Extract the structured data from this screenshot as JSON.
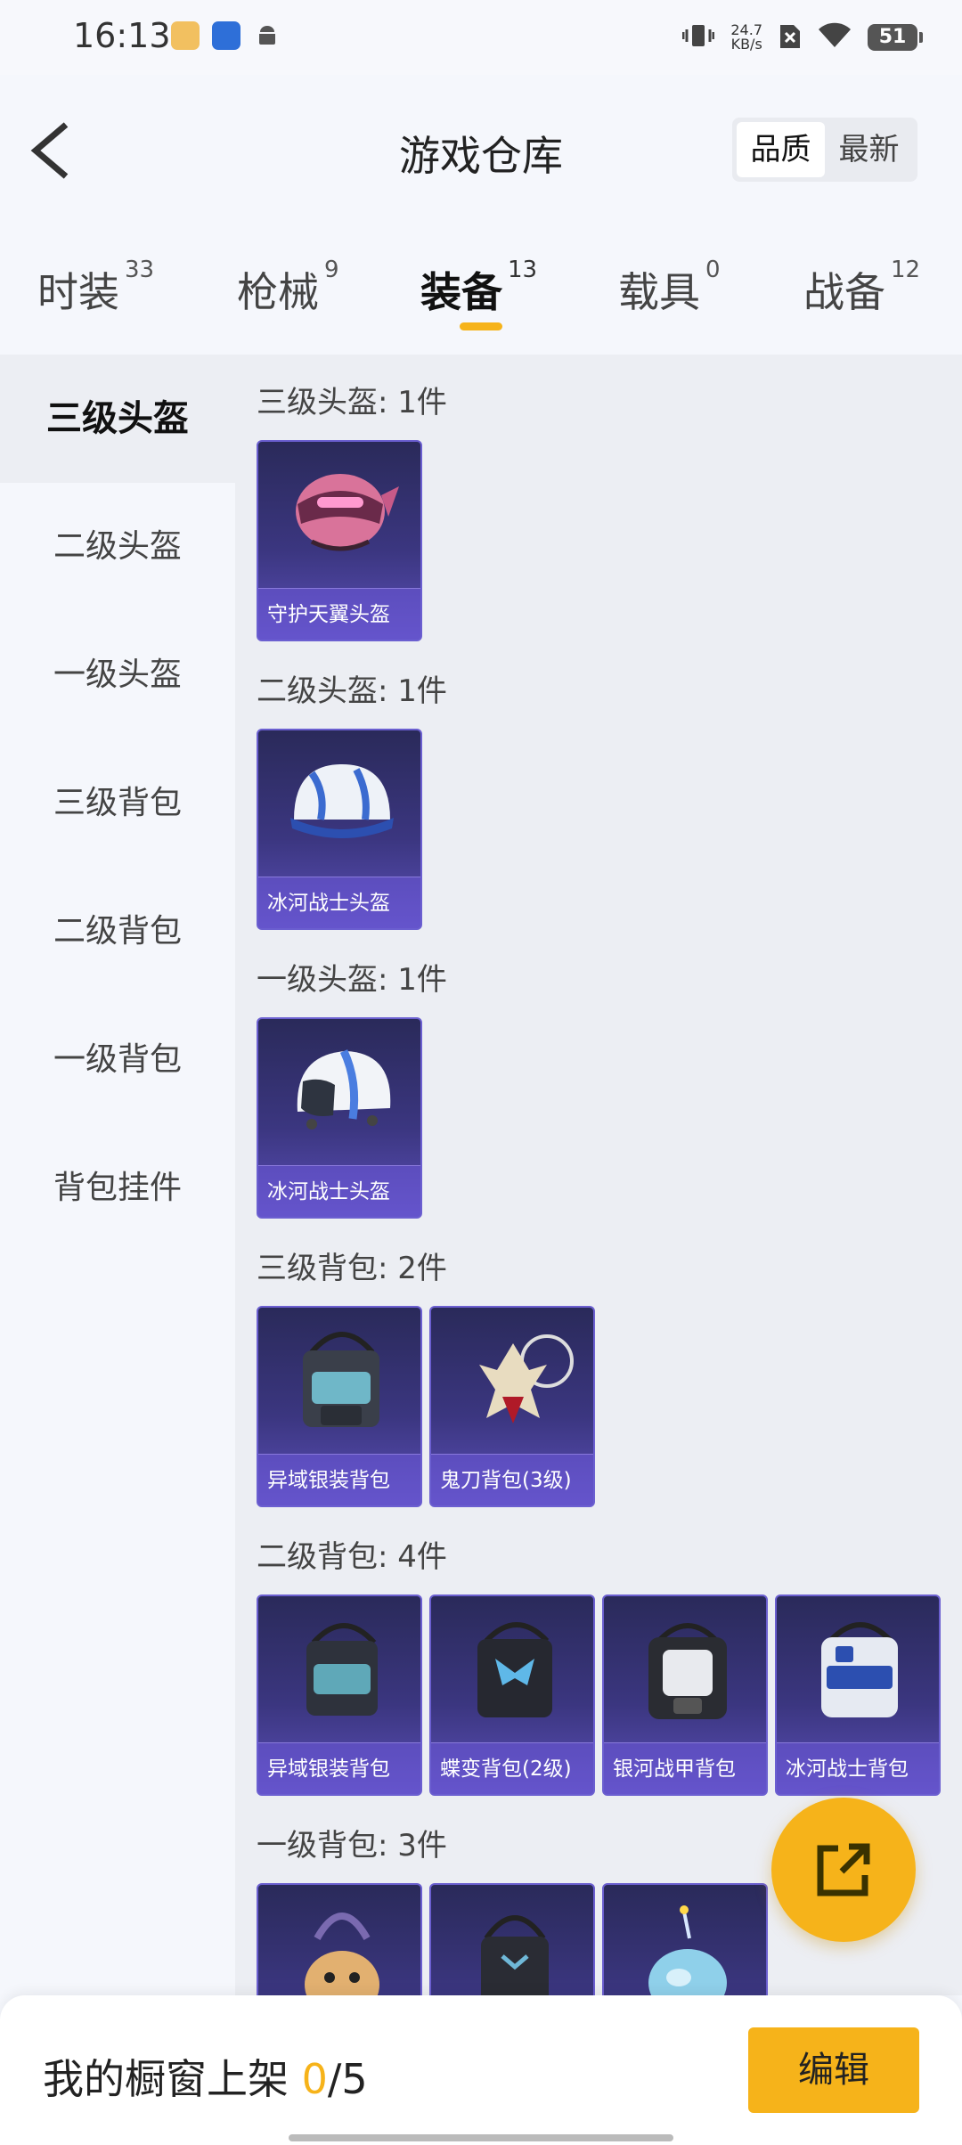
{
  "status": {
    "time": "16:13",
    "net_speed_value": "24.7",
    "net_speed_unit": "KB/s",
    "battery": "51"
  },
  "header": {
    "title": "游戏仓库",
    "sort_quality": "品质",
    "sort_newest": "最新"
  },
  "tabs": [
    {
      "label": "时装",
      "count": "33"
    },
    {
      "label": "枪械",
      "count": "9"
    },
    {
      "label": "装备",
      "count": "13"
    },
    {
      "label": "载具",
      "count": "0"
    },
    {
      "label": "战备",
      "count": "12"
    }
  ],
  "active_tab": "装备",
  "sidebar": {
    "items": [
      {
        "label": "三级头盔"
      },
      {
        "label": "二级头盔"
      },
      {
        "label": "一级头盔"
      },
      {
        "label": "三级背包"
      },
      {
        "label": "二级背包"
      },
      {
        "label": "一级背包"
      },
      {
        "label": "背包挂件"
      }
    ]
  },
  "sections": [
    {
      "title": "三级头盔: 1件",
      "items": [
        "守护天翼头盔"
      ]
    },
    {
      "title": "二级头盔: 1件",
      "items": [
        "冰河战士头盔"
      ]
    },
    {
      "title": "一级头盔: 1件",
      "items": [
        "冰河战士头盔"
      ]
    },
    {
      "title": "三级背包: 2件",
      "items": [
        "异域银装背包",
        "鬼刀背包(3级)"
      ]
    },
    {
      "title": "二级背包: 4件",
      "items": [
        "异域银装背包",
        "蝶变背包(2级)",
        "银河战甲背包",
        "冰河战士背包"
      ]
    },
    {
      "title": "一级背包: 3件",
      "items": [
        "",
        "",
        ""
      ]
    }
  ],
  "bottom": {
    "shelf_label": "我的橱窗上架 ",
    "shelf_count": "0",
    "shelf_total": "/5",
    "edit_label": "编辑"
  },
  "colors": {
    "accent": "#f6b31a",
    "card_bg": "#3b3680"
  }
}
